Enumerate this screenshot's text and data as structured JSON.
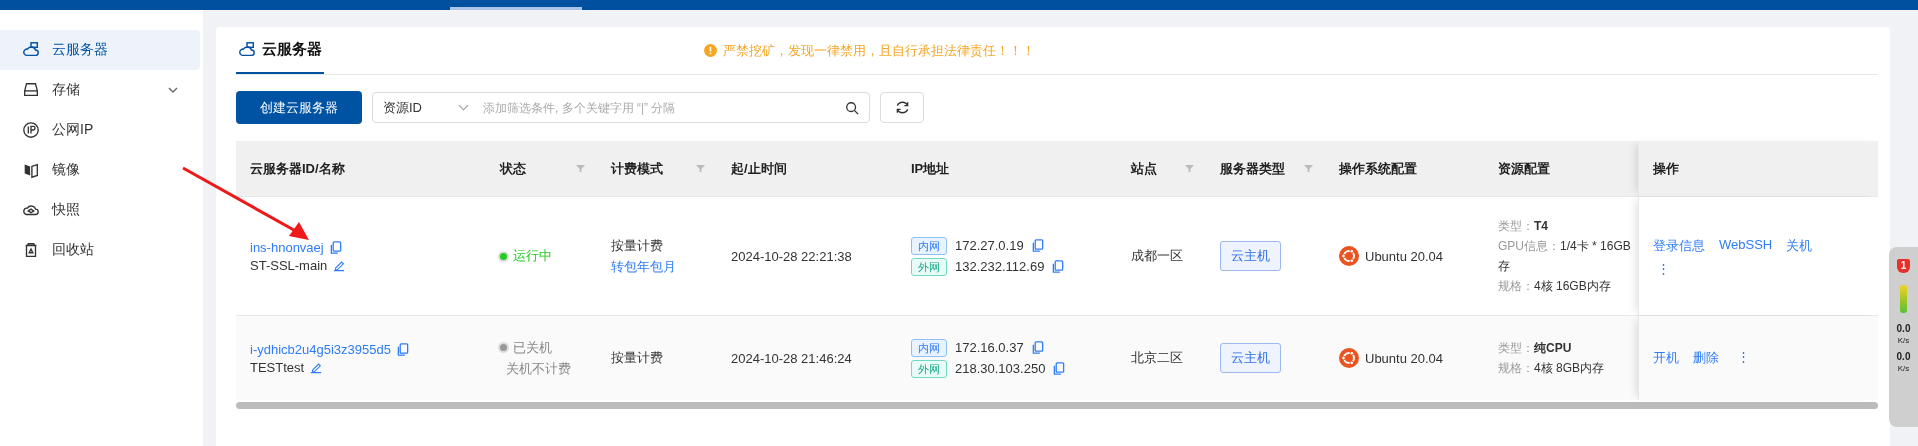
{
  "sidebar": {
    "items": [
      {
        "label": "云服务器",
        "selected": true,
        "expandable": false
      },
      {
        "label": "存储",
        "selected": false,
        "expandable": true
      },
      {
        "label": "公网IP",
        "selected": false,
        "expandable": false
      },
      {
        "label": "镜像",
        "selected": false,
        "expandable": false
      },
      {
        "label": "快照",
        "selected": false,
        "expandable": false
      },
      {
        "label": "回收站",
        "selected": false,
        "expandable": false
      }
    ]
  },
  "page": {
    "title": "云服务器",
    "warning": "严禁挖矿，发现一律禁用，且自行承担法律责任！！！"
  },
  "toolbar": {
    "create_button": "创建云服务器",
    "filter_select": "资源ID",
    "search_placeholder": "添加筛选条件, 多个关键字用 “|” 分隔"
  },
  "table": {
    "columns": [
      {
        "label": "云服务器ID/名称",
        "filter": false
      },
      {
        "label": "状态",
        "filter": true
      },
      {
        "label": "计费模式",
        "filter": true
      },
      {
        "label": "起/止时间",
        "filter": false
      },
      {
        "label": "IP地址",
        "filter": false
      },
      {
        "label": "站点",
        "filter": true
      },
      {
        "label": "服务器类型",
        "filter": true
      },
      {
        "label": "操作系统配置",
        "filter": false
      },
      {
        "label": "资源配置",
        "filter": false
      },
      {
        "label": "操作",
        "filter": false
      }
    ],
    "rows": [
      {
        "id": "ins-hnonvaej",
        "name": "ST-SSL-main",
        "status": {
          "kind": "running",
          "label": "运行中"
        },
        "billing": "按量计费",
        "billing_link": "转包年包月",
        "time": "2024-10-28 22:21:38",
        "ips": [
          {
            "kind": "inner",
            "tag": "内网",
            "address": "172.27.0.19"
          },
          {
            "kind": "outer",
            "tag": "外网",
            "address": "132.232.112.69"
          }
        ],
        "site": "成都一区",
        "server_type": "云主机",
        "os": "Ubuntu 20.04",
        "resources": [
          {
            "kind": "strong",
            "label": "类型：",
            "value": "T4"
          },
          {
            "kind": "plain",
            "label": "GPU信息：",
            "value": "1/4卡 * 16GB"
          },
          {
            "kind": "wrap",
            "value": "存"
          },
          {
            "kind": "plain",
            "label": "规格：",
            "value": "4核 16GB内存"
          }
        ],
        "actions": [
          {
            "kind": "link",
            "label": "登录信息"
          },
          {
            "kind": "link",
            "label": "WebSSH"
          },
          {
            "kind": "link",
            "label": "关机"
          },
          {
            "kind": "more",
            "label": "⋮"
          }
        ]
      },
      {
        "id": "i-ydhicb2u4g5i3z3955d5",
        "name": "TESTtest",
        "status": {
          "kind": "stopped",
          "label": "已关机",
          "note": "关机不计费"
        },
        "billing": "按量计费",
        "time": "2024-10-28 21:46:24",
        "ips": [
          {
            "kind": "inner",
            "tag": "内网",
            "address": "172.16.0.37"
          },
          {
            "kind": "outer",
            "tag": "外网",
            "address": "218.30.103.250"
          }
        ],
        "site": "北京二区",
        "server_type": "云主机",
        "os": "Ubuntu 20.04",
        "resources": [
          {
            "kind": "strong",
            "label": "类型：",
            "value": "纯CPU"
          },
          {
            "kind": "plain",
            "label": "规格：",
            "value": "4核 8GB内存"
          }
        ],
        "actions": [
          {
            "kind": "link",
            "label": "开机"
          },
          {
            "kind": "link",
            "label": "删除"
          },
          {
            "kind": "more",
            "label": "⋮"
          }
        ]
      }
    ]
  },
  "monitor_widget": {
    "badge": "1",
    "up": "0.0",
    "up_unit": "K/s",
    "down": "0.0",
    "down_unit": "K/s"
  }
}
